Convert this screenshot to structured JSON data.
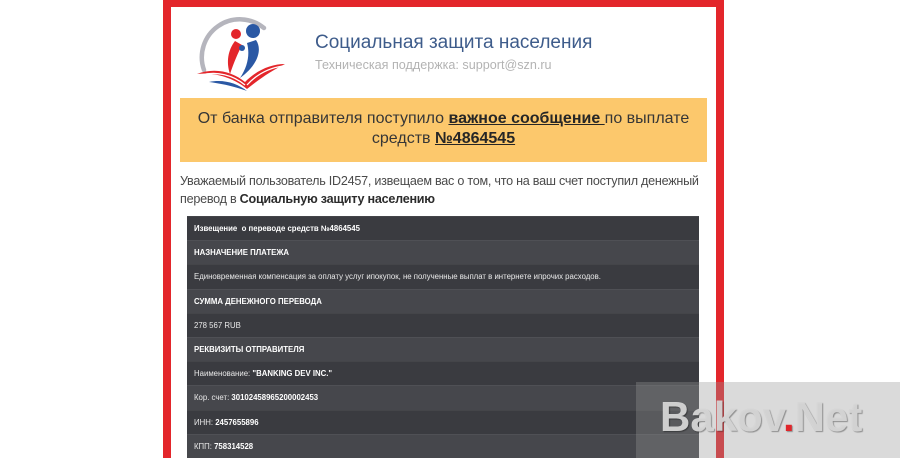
{
  "header": {
    "logo_icon": "social-protection-logo",
    "title": "Социальная защита населения",
    "support": "Техническая поддержка: support@szn.ru"
  },
  "banner": {
    "text_before": "От банка отправителя поступило ",
    "link_message": "важное сообщение ",
    "text_middle": "по выплате средств ",
    "link_number": "№4864545"
  },
  "intro": {
    "text": "Уважаемый пользователь ID2457, извещаем вас о том, что на ваш счет поступил денежный перевод в ",
    "bold": "Социальную защиту населению"
  },
  "notice": {
    "title": "Извещение  о переводе средств №4864545",
    "purpose_heading": "НАЗНАЧЕНИЕ ПЛАТЕЖА",
    "purpose": "Единовременная компенсация за оплату услуг ипокупок, не полученные выплат в интернете ипрочих расходов.",
    "amount_heading": "СУММА ДЕНЕЖНОГО ПЕРЕВОДА",
    "amount": "278 567 RUB",
    "sender_heading": "РЕКВИЗИТЫ ОТПРАВИТЕЛЯ",
    "sender_name": {
      "label": "Наименование: ",
      "value": "\"BANKING DEV INC.\""
    },
    "corr_account": {
      "label": "Кор. счет: ",
      "value": "30102458965200002453"
    },
    "inn": {
      "label": "ИНН: ",
      "value": "2457655896"
    },
    "kpp": {
      "label": "КПП: ",
      "value": "758314528"
    }
  },
  "watermark": {
    "part1": "Bakov",
    "dot": ".",
    "part2": "Net"
  },
  "colors": {
    "frame": "#e3262b",
    "banner": "#fcc86c",
    "title": "#3e5c8b",
    "row_dark": "#3a3b40",
    "row_light": "#46474c",
    "wm_dot": "#e0262b"
  }
}
